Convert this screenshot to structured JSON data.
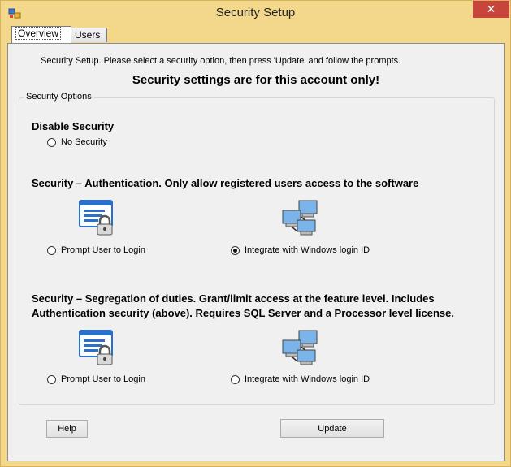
{
  "window": {
    "title": "Security Setup",
    "close_glyph": "✕"
  },
  "tabs": [
    {
      "label": "Overview",
      "active": true
    },
    {
      "label": "Users",
      "active": false
    }
  ],
  "intro_text": "Security Setup.  Please select a security option, then press 'Update' and follow the prompts.",
  "headline": "Security settings are for this account only!",
  "group_label": "Security Options",
  "disable_section": {
    "title": "Disable Security",
    "option": {
      "label": "No Security",
      "checked": false
    }
  },
  "auth_section": {
    "title": "Security – Authentication.  Only allow registered users access to the software",
    "options": [
      {
        "label": "Prompt User to Login",
        "checked": false,
        "icon": "login-lock-icon"
      },
      {
        "label": "Integrate with Windows login ID",
        "checked": true,
        "icon": "network-computers-icon"
      }
    ]
  },
  "segregation_section": {
    "title_line1": "Security – Segregation of duties. Grant/limit access at the feature level.  Includes",
    "title_line2": "Authentication security (above). Requires SQL Server and a Processor level license.",
    "options": [
      {
        "label": "Prompt User to Login",
        "checked": false,
        "icon": "login-lock-icon"
      },
      {
        "label": "Integrate with Windows login ID",
        "checked": false,
        "icon": "network-computers-icon"
      }
    ]
  },
  "buttons": {
    "help": "Help",
    "update": "Update"
  },
  "colors": {
    "frame": "#f3d78a",
    "close": "#c7453b",
    "page": "#f0f0f0"
  }
}
